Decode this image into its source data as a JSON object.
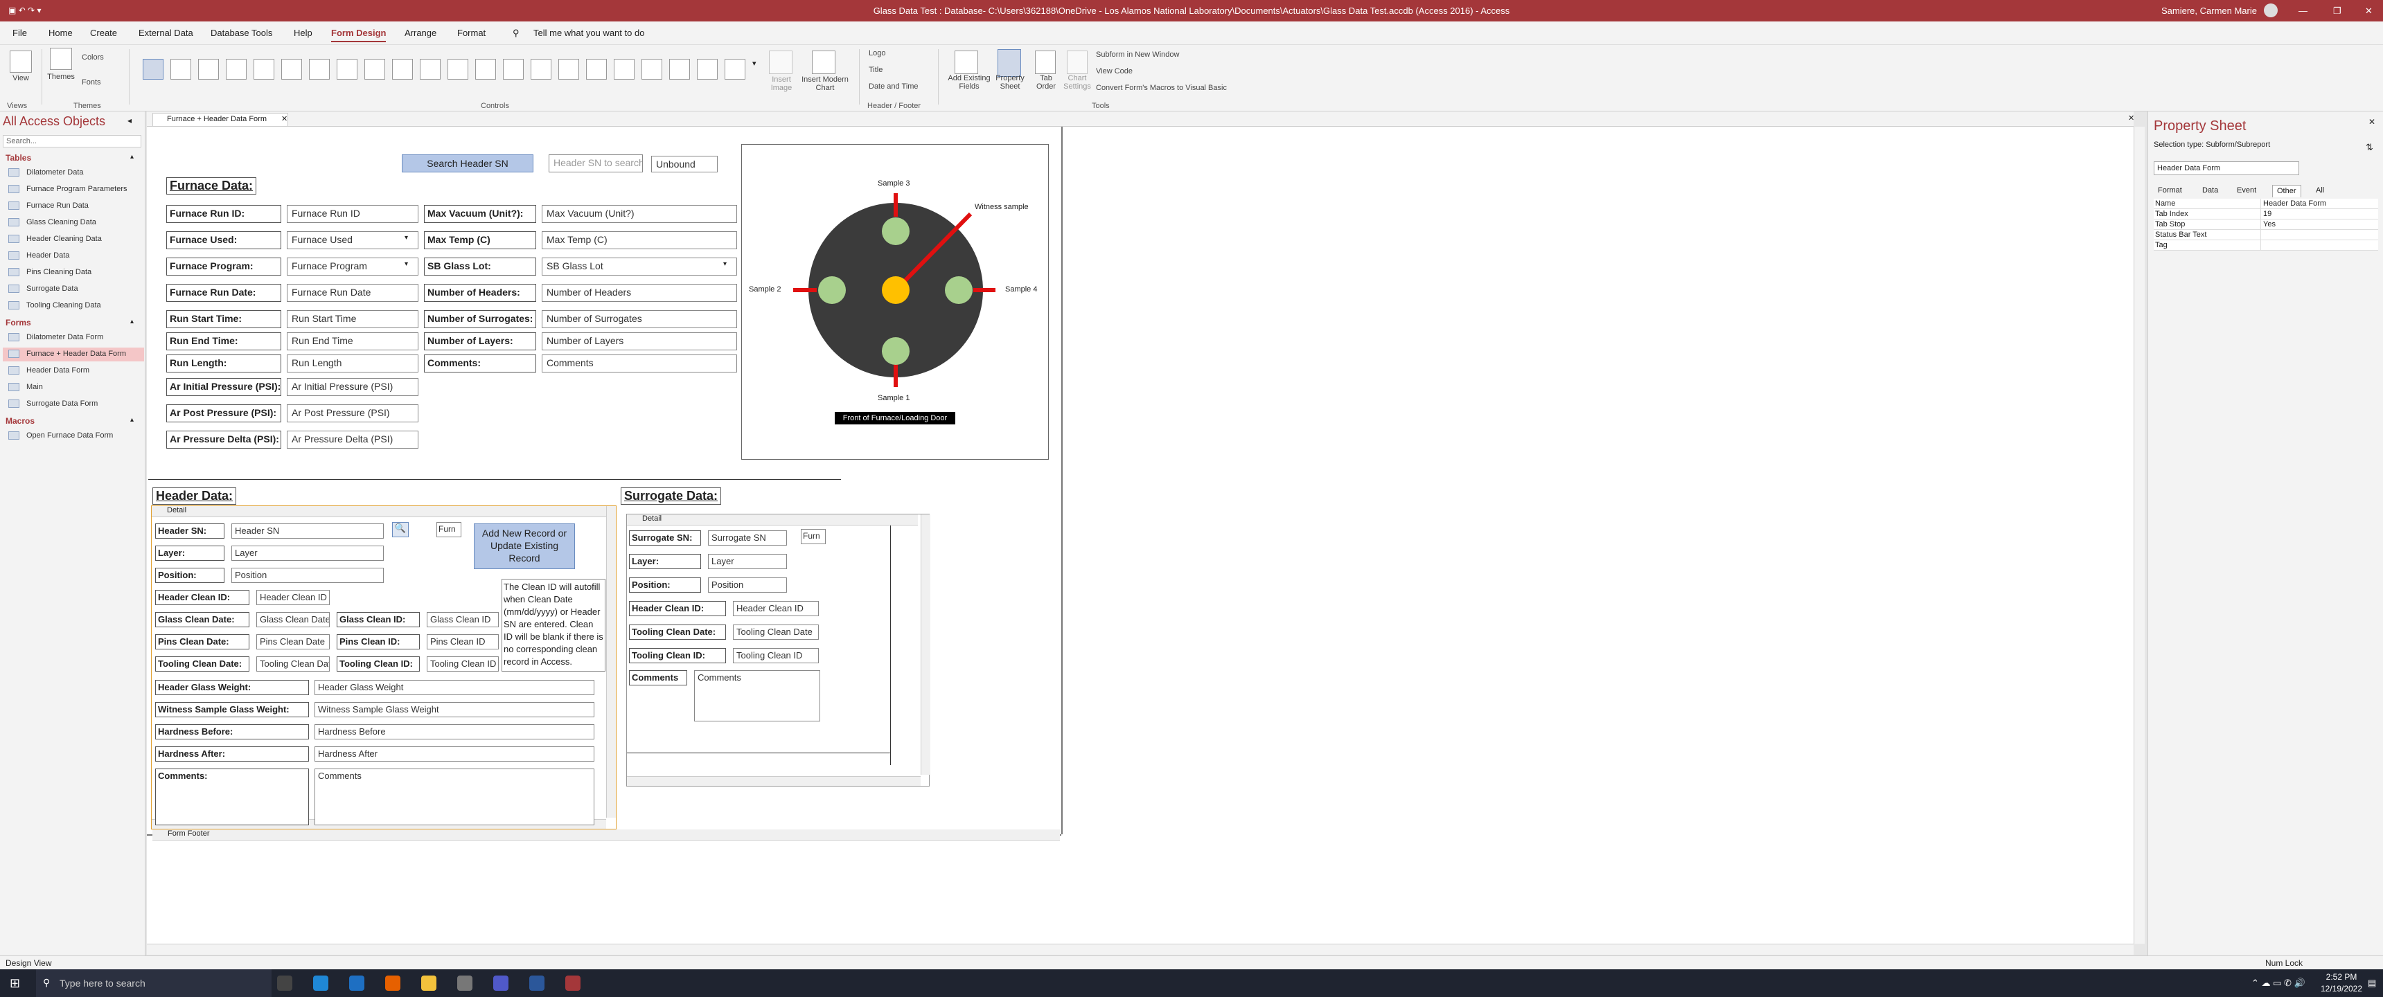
{
  "title_bar": {
    "window_title": "Glass Data Test : Database- C:\\Users\\362188\\OneDrive - Los Alamos National Laboratory\\Documents\\Actuators\\Glass Data Test.accdb (Access 2016) - Access",
    "user": "Samiere, Carmen Marie"
  },
  "menu": {
    "items": [
      "File",
      "Home",
      "Create",
      "External Data",
      "Database Tools",
      "Help",
      "Form Design",
      "Arrange",
      "Format"
    ],
    "active": "Form Design",
    "tell_me": "Tell me what you want to do"
  },
  "ribbon": {
    "views": {
      "view": "View",
      "group": "Views"
    },
    "themes": {
      "themes": "Themes",
      "colors": "Colors",
      "fonts": "Fonts",
      "group": "Themes"
    },
    "controls_group": "Controls",
    "insert_image": "Insert Image",
    "insert_chart": "Insert Modern Chart",
    "header_footer": {
      "logo": "Logo",
      "title": "Title",
      "date_time": "Date and Time",
      "group": "Header / Footer"
    },
    "tools": {
      "add_existing": "Add Existing Fields",
      "property_sheet": "Property Sheet",
      "tab_order": "Tab Order",
      "chart_settings": "Chart Settings",
      "subform_window": "Subform in New Window",
      "view_code": "View Code",
      "convert_macros": "Convert Form's Macros to Visual Basic",
      "group": "Tools"
    }
  },
  "nav": {
    "title": "All Access Objects",
    "search_placeholder": "Search...",
    "sections": [
      {
        "name": "Tables",
        "items": [
          "Dilatometer Data",
          "Furnace Program Parameters",
          "Furnace Run Data",
          "Glass Cleaning Data",
          "Header Cleaning Data",
          "Header Data",
          "Pins Cleaning Data",
          "Surrogate Data",
          "Tooling Cleaning Data"
        ]
      },
      {
        "name": "Forms",
        "items": [
          "Dilatometer Data Form",
          "Furnace + Header Data Form",
          "Header Data Form",
          "Main",
          "Surrogate Data Form"
        ]
      },
      {
        "name": "Macros",
        "items": [
          "Open Furnace Data Form"
        ]
      }
    ],
    "active_item": "Furnace + Header Data Form"
  },
  "doc_tab": "Furnace + Header Data Form",
  "form": {
    "search_button": "Search Header SN",
    "search_placeholder": "Header SN to search:",
    "unbound": "Unbound",
    "furnace_title": "Furnace Data:",
    "left_fields": [
      {
        "label": "Furnace Run ID:",
        "value": "Furnace Run ID"
      },
      {
        "label": "Furnace Used:",
        "value": "Furnace Used"
      },
      {
        "label": "Furnace Program:",
        "value": "Furnace Program"
      },
      {
        "label": "Furnace Run Date:",
        "value": "Furnace Run Date"
      },
      {
        "label": "Run Start Time:",
        "value": "Run Start Time"
      },
      {
        "label": "Run End Time:",
        "value": "Run End Time"
      },
      {
        "label": "Run Length:",
        "value": "Run Length"
      },
      {
        "label": "Ar Initial Pressure (PSI):",
        "value": "Ar Initial Pressure (PSI)"
      },
      {
        "label": "Ar Post Pressure (PSI):",
        "value": "Ar Post Pressure (PSI)"
      },
      {
        "label": "Ar Pressure Delta (PSI):",
        "value": "Ar Pressure Delta (PSI)"
      }
    ],
    "right_fields": [
      {
        "label": "Max Vacuum (Unit?):",
        "value": "Max Vacuum (Unit?)"
      },
      {
        "label": "Max Temp (C)",
        "value": "Max Temp (C)"
      },
      {
        "label": "SB Glass Lot:",
        "value": "SB Glass Lot"
      },
      {
        "label": "Number of Headers:",
        "value": "Number of Headers"
      },
      {
        "label": "Number of Surrogates:",
        "value": "Number of Surrogates"
      },
      {
        "label": "Number of Layers:",
        "value": "Number of Layers"
      },
      {
        "label": "Comments:",
        "value": "Comments"
      }
    ],
    "diagram": {
      "samples": [
        "Sample 3",
        "Sample 2",
        "Sample 4",
        "Sample 1"
      ],
      "witness": "Witness sample",
      "caption": "Front of Furnace/Loading Door"
    },
    "header_title": "Header Data:",
    "detail_band": "Detail",
    "header_fields": {
      "sn": {
        "label": "Header SN:",
        "value": "Header SN"
      },
      "furn": "Furn",
      "layer": {
        "label": "Layer:",
        "value": "Layer"
      },
      "position": {
        "label": "Position:",
        "value": "Position"
      },
      "clean_id": {
        "label": "Header Clean ID:",
        "value": "Header Clean ID"
      },
      "glass_date": {
        "label": "Glass Clean Date:",
        "value": "Glass Clean Date"
      },
      "glass_id": {
        "label": "Glass Clean ID:",
        "value": "Glass Clean ID"
      },
      "pins_date": {
        "label": "Pins Clean Date:",
        "value": "Pins Clean Date"
      },
      "pins_id": {
        "label": "Pins Clean ID:",
        "value": "Pins Clean ID"
      },
      "tool_date": {
        "label": "Tooling Clean Date:",
        "value": "Tooling Clean Date"
      },
      "tool_id": {
        "label": "Tooling Clean ID:",
        "value": "Tooling Clean ID"
      },
      "weight": {
        "label": "Header Glass Weight:",
        "value": "Header Glass Weight"
      },
      "witness": {
        "label": "Witness Sample Glass Weight:",
        "value": "Witness Sample Glass Weight"
      },
      "hb": {
        "label": "Hardness Before:",
        "value": "Hardness Before"
      },
      "ha": {
        "label": "Hardness After:",
        "value": "Hardness After"
      },
      "comments": {
        "label": "Comments:",
        "value": "Comments"
      }
    },
    "add_button": "Add New Record or Update Existing Record",
    "note": "The Clean ID will autofill when Clean Date (mm/dd/yyyy) or Header SN are entered. Clean ID will be blank if there is no corresponding clean record in Access.",
    "surrogate_title": "Surrogate Data:",
    "surrogate_fields": {
      "sn": {
        "label": "Surrogate SN:",
        "value": "Surrogate SN"
      },
      "furn": "Furn",
      "layer": {
        "label": "Layer:",
        "value": "Layer"
      },
      "position": {
        "label": "Position:",
        "value": "Position"
      },
      "hcid": {
        "label": "Header Clean ID:",
        "value": "Header Clean ID"
      },
      "tcd": {
        "label": "Tooling Clean Date:",
        "value": "Tooling Clean Date"
      },
      "tcid": {
        "label": "Tooling Clean ID:",
        "value": "Tooling Clean ID"
      },
      "comments": {
        "label": "Comments",
        "value": "Comments"
      }
    },
    "form_footer": "Form Footer"
  },
  "property_sheet": {
    "title": "Property Sheet",
    "selection_type": "Selection type:  Subform/Subreport",
    "selected": "Header Data Form",
    "tabs": [
      "Format",
      "Data",
      "Event",
      "Other",
      "All"
    ],
    "active_tab": "Other",
    "rows": [
      {
        "name": "Name",
        "value": "Header Data Form"
      },
      {
        "name": "Tab Index",
        "value": "19"
      },
      {
        "name": "Tab Stop",
        "value": "Yes"
      },
      {
        "name": "Status Bar Text",
        "value": ""
      },
      {
        "name": "Tag",
        "value": ""
      }
    ]
  },
  "status": {
    "left": "Design View",
    "num_lock": "Num Lock"
  },
  "taskbar": {
    "search": "Type here to search",
    "time": "2:52 PM",
    "date": "12/19/2022"
  }
}
